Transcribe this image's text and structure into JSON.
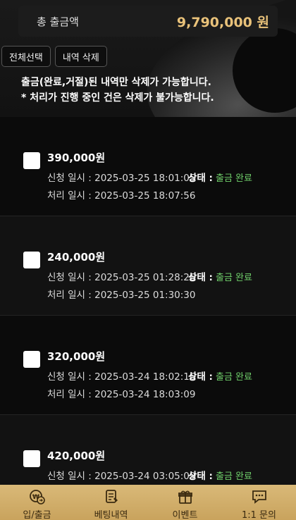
{
  "summary": {
    "label": "총 출금액",
    "value": "9,790,000 원"
  },
  "actions": {
    "select_all": "전체선택",
    "delete": "내역 삭제"
  },
  "notice": {
    "line1": "출금(완료,거절)된 내역만 삭제가 가능합니다.",
    "line2": "* 처리가 진행 중인 건은 삭제가 불가능합니다."
  },
  "labels": {
    "requested": "신청 일시 : ",
    "processed": "처리 일시 : ",
    "status": "상태 : "
  },
  "items": [
    {
      "amount": "390,000원",
      "requested_at": "2025-03-25 18:01:05",
      "processed_at": "2025-03-25 18:07:56",
      "status": "출금 완료"
    },
    {
      "amount": "240,000원",
      "requested_at": "2025-03-25 01:28:26",
      "processed_at": "2025-03-25 01:30:30",
      "status": "출금 완료"
    },
    {
      "amount": "320,000원",
      "requested_at": "2025-03-24 18:02:16",
      "processed_at": "2025-03-24 18:03:09",
      "status": "출금 완료"
    },
    {
      "amount": "420,000원",
      "requested_at": "2025-03-24 03:05:09",
      "processed_at": "",
      "status": "출금 완료"
    }
  ],
  "tabs": [
    {
      "label": "입/출금",
      "icon": "won-exchange-icon"
    },
    {
      "label": "베팅내역",
      "icon": "document-list-icon"
    },
    {
      "label": "이벤트",
      "icon": "gift-icon"
    },
    {
      "label": "1:1 문의",
      "icon": "chat-bubble-icon"
    }
  ],
  "colors": {
    "accent_gold": "#e9c27a",
    "status_green": "#6fcf6a",
    "tabbar": "#d4b06a"
  }
}
